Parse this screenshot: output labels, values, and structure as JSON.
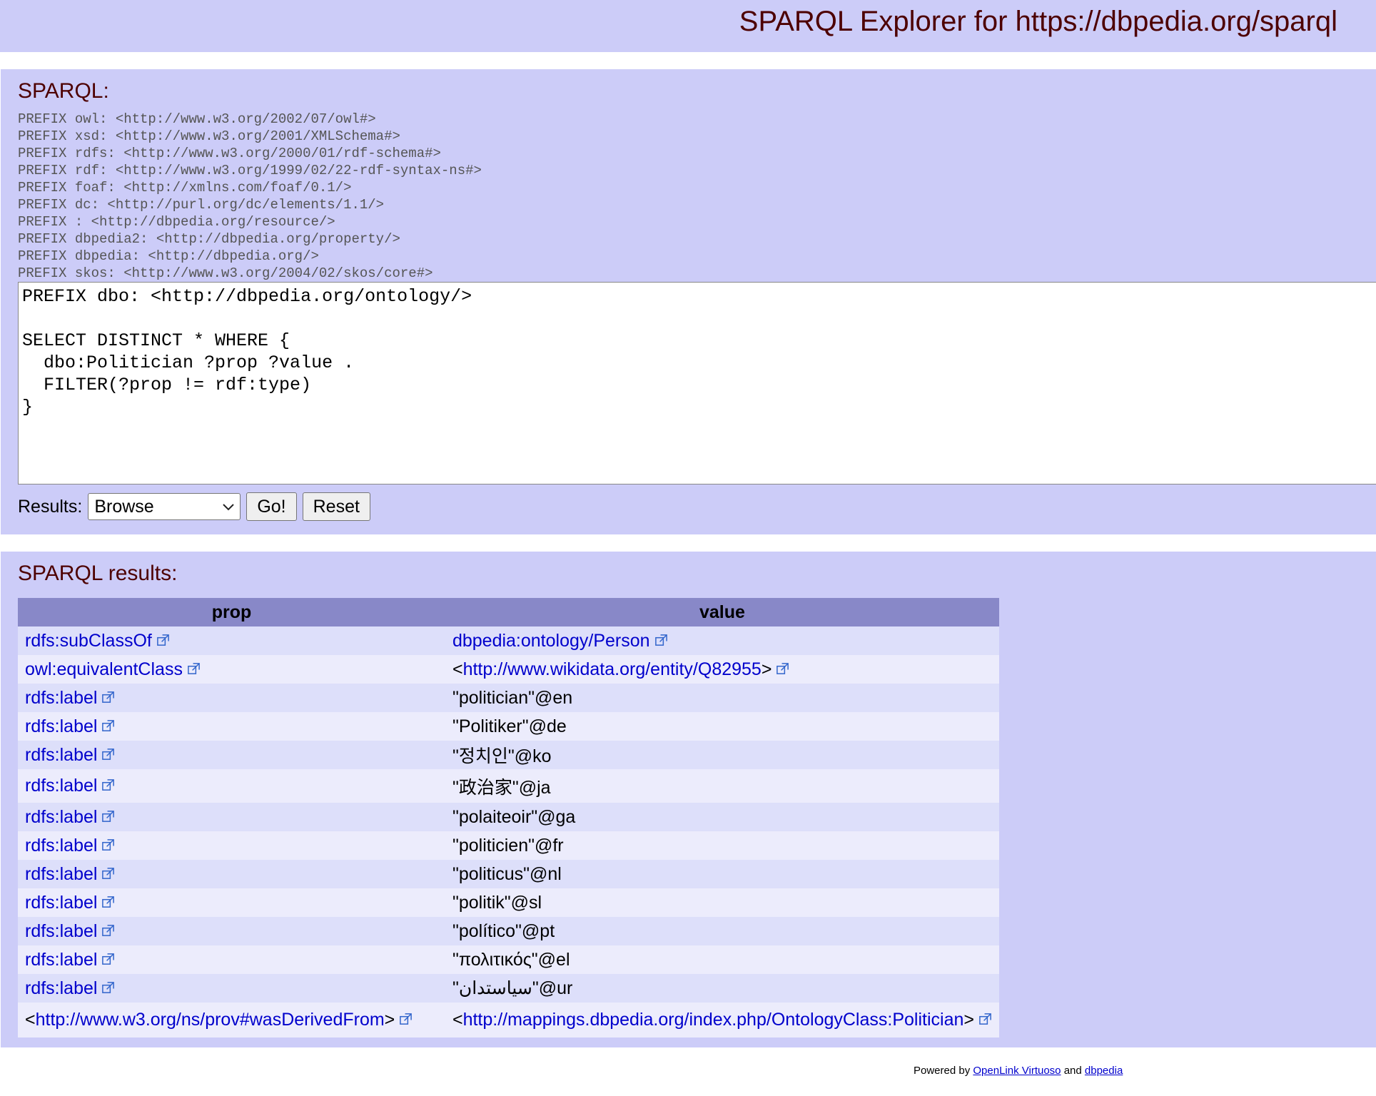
{
  "header": {
    "title": "SPARQL Explorer for https://dbpedia.org/sparql"
  },
  "query_panel": {
    "heading": "SPARQL:",
    "prefixes": [
      "PREFIX owl: <http://www.w3.org/2002/07/owl#>",
      "PREFIX xsd: <http://www.w3.org/2001/XMLSchema#>",
      "PREFIX rdfs: <http://www.w3.org/2000/01/rdf-schema#>",
      "PREFIX rdf: <http://www.w3.org/1999/02/22-rdf-syntax-ns#>",
      "PREFIX foaf: <http://xmlns.com/foaf/0.1/>",
      "PREFIX dc: <http://purl.org/dc/elements/1.1/>",
      "PREFIX : <http://dbpedia.org/resource/>",
      "PREFIX dbpedia2: <http://dbpedia.org/property/>",
      "PREFIX dbpedia: <http://dbpedia.org/>",
      "PREFIX skos: <http://www.w3.org/2004/02/skos/core#>"
    ],
    "query_lines": [
      "PREFIX dbo: <http://dbpedia.org/ontology/>",
      "",
      "SELECT DISTINCT * WHERE {",
      "  dbo:Politician ?prop ?value .",
      "  FILTER(?prop != rdf:type)",
      "}"
    ],
    "results_label": "Results:",
    "results_format": "Browse",
    "go_label": "Go!",
    "reset_label": "Reset"
  },
  "results_panel": {
    "heading": "SPARQL results:",
    "columns": [
      "prop",
      "value"
    ],
    "rows": [
      {
        "prop": "rdfs:subClassOf",
        "value": "dbpedia:ontology/Person"
      },
      {
        "prop": "owl:equivalentClass",
        "value": "http://www.wikidata.org/entity/Q82955"
      },
      {
        "prop": "rdfs:label",
        "value": "\"politician\"@en"
      },
      {
        "prop": "rdfs:label",
        "value": "\"Politiker\"@de"
      },
      {
        "prop": "rdfs:label",
        "value": "\"정치인\"@ko"
      },
      {
        "prop": "rdfs:label",
        "value": "\"政治家\"@ja"
      },
      {
        "prop": "rdfs:label",
        "value": "\"polaiteoir\"@ga"
      },
      {
        "prop": "rdfs:label",
        "value": "\"politicien\"@fr"
      },
      {
        "prop": "rdfs:label",
        "value": "\"politicus\"@nl"
      },
      {
        "prop": "rdfs:label",
        "value": "\"politik\"@sl"
      },
      {
        "prop": "rdfs:label",
        "value": "\"político\"@pt"
      },
      {
        "prop": "rdfs:label",
        "value": "\"πολιτικός\"@el"
      },
      {
        "prop": "rdfs:label",
        "value": "\"سیاستدان\"@ur"
      },
      {
        "prop": "http://www.w3.org/ns/prov#wasDerivedFrom",
        "value": "http://mappings.dbpedia.org/index.php/OntologyClass:Politician"
      }
    ]
  },
  "footer": {
    "powered_by": "Powered by",
    "virtuoso_link": "OpenLink Virtuoso",
    "and_text": "and",
    "dbpedia_link": "dbpedia"
  }
}
